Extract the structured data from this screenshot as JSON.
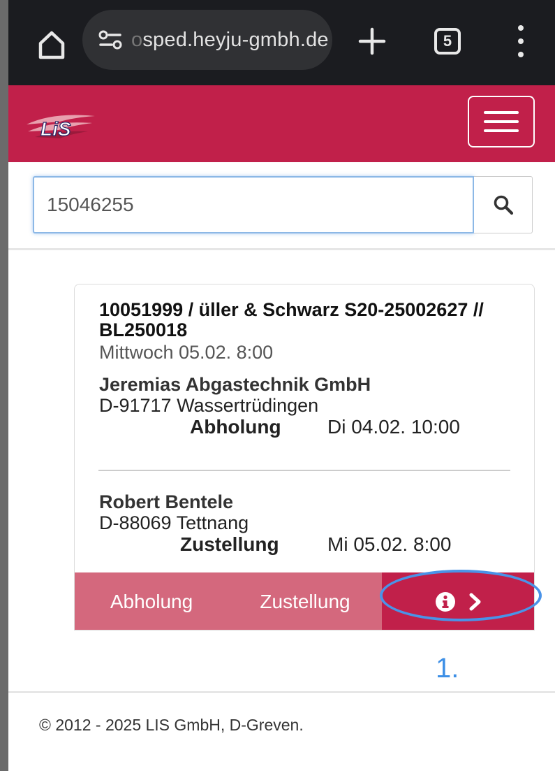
{
  "browser": {
    "url": "sped.heyju-gmbh.de",
    "url_prefix_fade": "o",
    "tab_count": "5"
  },
  "header": {
    "logo_text": "LiS",
    "colors": {
      "brand": "#c1204a",
      "brand_light": "#d4687d"
    }
  },
  "search": {
    "value": "15046255",
    "button_icon": "search-icon"
  },
  "order": {
    "title": "10051999 / üller & Schwarz S20-25002627 // BL250018",
    "date": "Mittwoch 05.02.  8:00",
    "pickup": {
      "name": "Jeremias Abgastechnik GmbH",
      "city": "D-91717 Wassertrüdingen",
      "type": "Abholung",
      "time": "Di 04.02.  10:00"
    },
    "delivery": {
      "name": "Robert Bentele",
      "city": "D-88069 Tettnang",
      "type": "Zustellung",
      "time": "Mi 05.02.  8:00"
    }
  },
  "actions": {
    "abholung": "Abholung",
    "zustellung": "Zustellung",
    "info_icon": "info-icon",
    "next_icon": "chevron-right-icon"
  },
  "annotation": {
    "step": "1."
  },
  "footer": {
    "copyright": "© 2012 - 2025 LIS GmbH, D-Greven."
  }
}
